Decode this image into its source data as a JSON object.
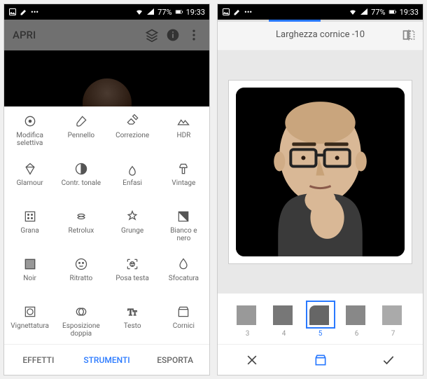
{
  "statusbar": {
    "battery": "77%",
    "time": "19:33"
  },
  "left": {
    "header": {
      "title": "APRI"
    },
    "tools": [
      {
        "key": "modifica-selettiva",
        "label": "Modifica\nselettiva"
      },
      {
        "key": "pennello",
        "label": "Pennello"
      },
      {
        "key": "correzione",
        "label": "Correzione"
      },
      {
        "key": "hdr",
        "label": "HDR"
      },
      {
        "key": "glamour",
        "label": "Glamour"
      },
      {
        "key": "contr-tonale",
        "label": "Contr. tonale"
      },
      {
        "key": "enfasi",
        "label": "Enfasi"
      },
      {
        "key": "vintage",
        "label": "Vintage"
      },
      {
        "key": "grana",
        "label": "Grana"
      },
      {
        "key": "retrolux",
        "label": "Retrolux"
      },
      {
        "key": "grunge",
        "label": "Grunge"
      },
      {
        "key": "bianco-nero",
        "label": "Bianco e\nnero"
      },
      {
        "key": "noir",
        "label": "Noir"
      },
      {
        "key": "ritratto",
        "label": "Ritratto"
      },
      {
        "key": "posa-testa",
        "label": "Posa testa"
      },
      {
        "key": "sfocatura",
        "label": "Sfocatura"
      },
      {
        "key": "vignettatura",
        "label": "Vignettatura"
      },
      {
        "key": "esposizione-doppia",
        "label": "Esposizione\ndoppia"
      },
      {
        "key": "testo",
        "label": "Testo"
      },
      {
        "key": "cornici",
        "label": "Cornici"
      }
    ],
    "tabs": {
      "effetti": "EFFETTI",
      "strumenti": "STRUMENTI",
      "esporta": "ESPORTA",
      "active": "strumenti"
    }
  },
  "right": {
    "slider_label": "Larghezza cornice -10",
    "thumbs": [
      {
        "n": "3",
        "radius": "0px",
        "shade": "#999"
      },
      {
        "n": "4",
        "radius": "0px",
        "shade": "#777"
      },
      {
        "n": "5",
        "radius": "8px",
        "shade": "#666",
        "selected": true
      },
      {
        "n": "6",
        "radius": "0px",
        "shade": "#888"
      },
      {
        "n": "7",
        "radius": "0px",
        "shade": "#aaa"
      }
    ]
  }
}
